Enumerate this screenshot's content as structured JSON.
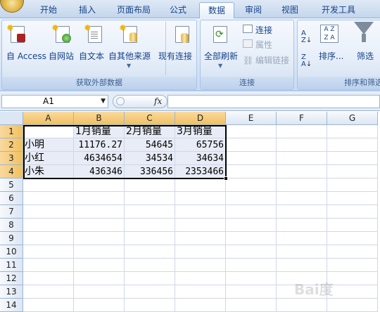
{
  "tabs": [
    "开始",
    "插入",
    "页面布局",
    "公式",
    "数据",
    "审阅",
    "视图",
    "开发工具"
  ],
  "active_tab": "数据",
  "ribbon": {
    "external_group": {
      "label": "获取外部数据",
      "buttons": [
        "自 Access",
        "自网站",
        "自文本",
        "自其他来源",
        "现有连接"
      ]
    },
    "connection_group": {
      "label": "连接",
      "refresh_all": "全部刷新",
      "connections": "连接",
      "properties": "属性",
      "edit_links": "编辑链接"
    },
    "sort_group": {
      "label": "排序和筛选",
      "sort_az": "A↓Z",
      "sort_za": "Z↓A",
      "sort": "排序...",
      "filter": "筛选"
    }
  },
  "formula_bar": {
    "name_box": "A1",
    "fx": "fx",
    "formula": ""
  },
  "columns": [
    "A",
    "B",
    "C",
    "D",
    "E",
    "F",
    "G"
  ],
  "rows": [
    "1",
    "2",
    "3",
    "4",
    "5",
    "6",
    "7",
    "8",
    "9",
    "10",
    "11",
    "12",
    "13",
    "14"
  ],
  "table": {
    "header": [
      "",
      "1月销量",
      "2月销量",
      "3月销量"
    ],
    "data": [
      [
        "小明",
        "11176.27",
        "54645",
        "65756"
      ],
      [
        "小红",
        "4634654",
        "34534",
        "34634"
      ],
      [
        "小朱",
        "436346",
        "336456",
        "2353466"
      ]
    ]
  },
  "colors": {
    "selection_header": "#f1c15f",
    "ribbon_text": "#15428b"
  }
}
